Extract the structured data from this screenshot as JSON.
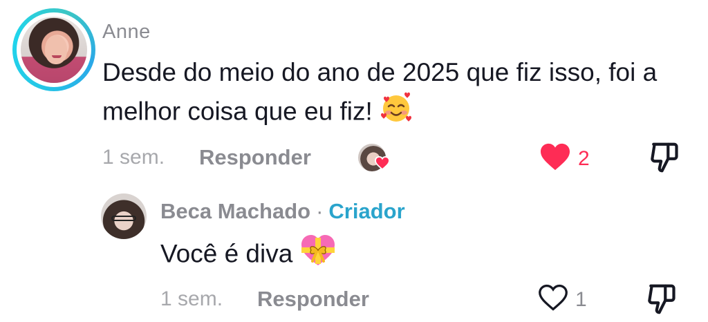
{
  "comment": {
    "username": "Anne",
    "text": "Desde do meio do ano de 2025 que fiz isso, foi a melhor coisa que eu fiz!",
    "emoji": "smiling-face-with-hearts",
    "time": "1 sem.",
    "reply_label": "Responder",
    "creator_liked": true,
    "liked": true,
    "like_count": "2"
  },
  "reply": {
    "username": "Beca Machado",
    "separator": "·",
    "badge": "Criador",
    "text": "Você é diva",
    "emoji": "heart-with-ribbon",
    "time": "1 sem.",
    "reply_label": "Responder",
    "liked": false,
    "like_count": "1"
  },
  "colors": {
    "like_red": "#fe2c55",
    "creator_blue": "#2aa4cc",
    "muted_text": "#8a8b91",
    "ring": "#25c7e6"
  }
}
